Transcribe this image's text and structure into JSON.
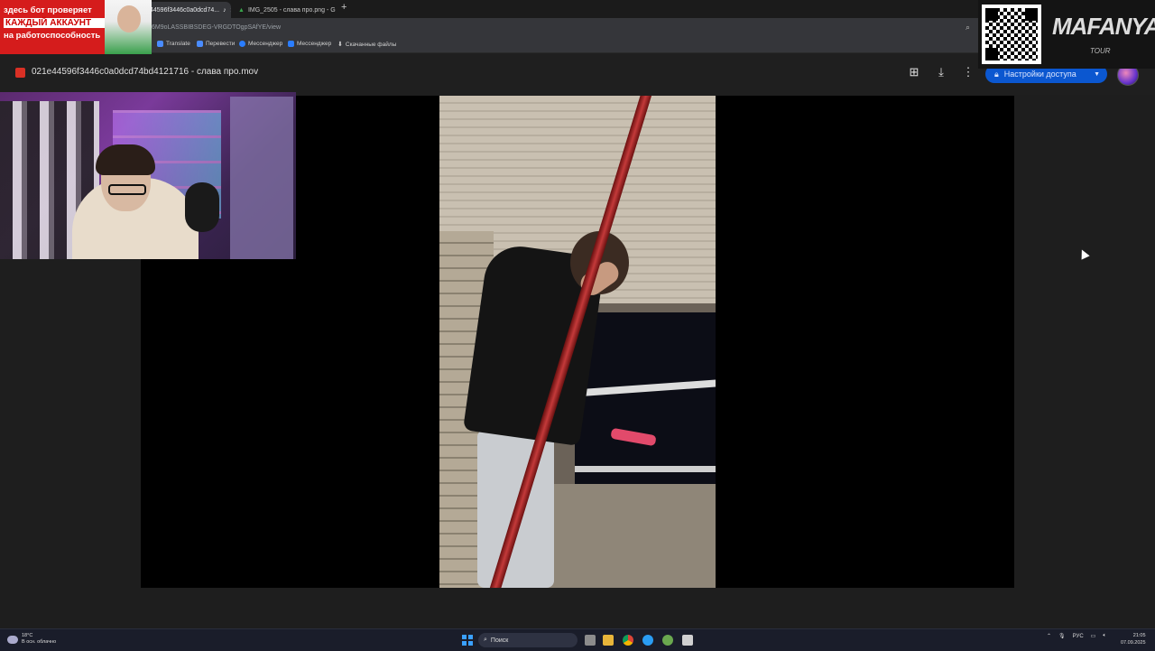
{
  "tabs": [
    {
      "label": "44596f3446c0a0dcd74...",
      "active": true
    },
    {
      "label": "IMG_2505 - слава про.png - G",
      "active": false
    }
  ],
  "new_tab_label": "+",
  "address": {
    "url": "6M9oLASSBIBSDEG-VRGDTOgpSAfYE/view"
  },
  "bookmarks": [
    {
      "label": "Translate",
      "color": "#4a8cff"
    },
    {
      "label": "Перевести",
      "color": "#4a8cff"
    },
    {
      "label": "Мессенджер",
      "color": "#2a7dff"
    },
    {
      "label": "Мессенджер",
      "color": "#2a7dff"
    },
    {
      "label": "Скачанные файлы",
      "color": "#aaaaaa"
    }
  ],
  "viewer": {
    "file_title": "021e44596f3446c0a0dcd74bd4121716 - слава про.mov",
    "share_label": "Настройки доступа",
    "icons": [
      "add-shortcut-icon",
      "download-icon",
      "more-vert-icon"
    ]
  },
  "promo": {
    "line1": "здесь бот проверяет",
    "line2": "КАЖДЫЙ АККАУНТ",
    "line3": "на работоспособность"
  },
  "brand": {
    "name": "MAFANYA",
    "sub": "TOUR"
  },
  "taskbar": {
    "weather_temp": "18°C",
    "weather_desc": "В осн. облачно",
    "search_label": "Поиск",
    "lang": "РУС",
    "time": "21:05",
    "date": "07.09.2025"
  },
  "colors": {
    "accent": "#0b57d0",
    "promo_red": "#d51c1c"
  }
}
